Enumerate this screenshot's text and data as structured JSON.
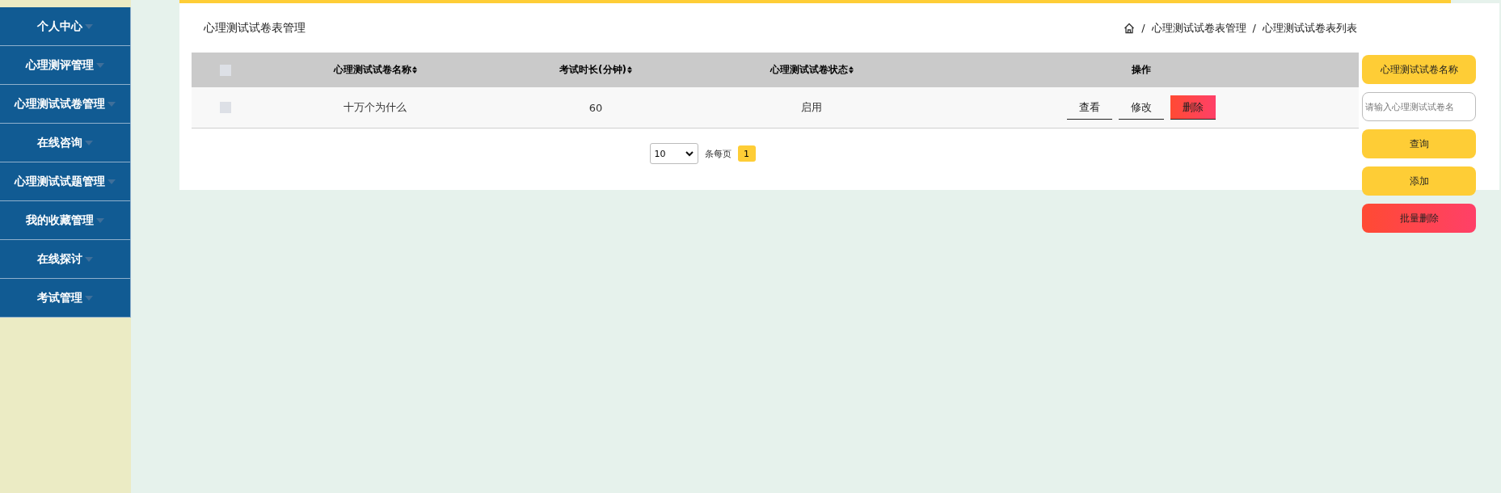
{
  "sidebar": {
    "items": [
      {
        "label": "个人中心",
        "expanded": false
      },
      {
        "label": "心理测评管理",
        "expanded": false
      },
      {
        "label": "心理测试试卷管理",
        "expanded": false
      },
      {
        "label": "在线咨询",
        "expanded": false
      },
      {
        "label": "心理测试试题管理",
        "expanded": false
      },
      {
        "label": "我的收藏管理",
        "expanded": false
      },
      {
        "label": "在线探讨",
        "expanded": false
      },
      {
        "label": "考试管理",
        "expanded": false
      }
    ]
  },
  "page_title": "心理测试试卷表管理",
  "breadcrumb": [
    {
      "separator": "/",
      "label": "心理测试试卷表管理"
    },
    {
      "separator": "/",
      "label": "心理测试试卷表列表"
    }
  ],
  "table": {
    "select_all_checked": false,
    "columns": [
      "心理测试试卷名称",
      "考试时长(分钟)",
      "心理测试试卷状态",
      "操作"
    ],
    "rows": [
      {
        "checked": false,
        "cells": [
          "十万个为什么",
          "60",
          "启用"
        ],
        "actions": [
          {
            "label": "查看",
            "kind": "plain"
          },
          {
            "label": "修改",
            "kind": "plain"
          },
          {
            "label": "删除",
            "kind": "danger"
          }
        ]
      }
    ]
  },
  "pagination": {
    "page_size": "10",
    "per_page_label": "条每页",
    "pages": [
      {
        "label": "1",
        "selected": true
      }
    ]
  },
  "search": {
    "label": "心理测试试卷名称",
    "placeholder": "请输入心理测试试卷名"
  },
  "buttons": [
    {
      "label": "查询",
      "kind": "primary"
    },
    {
      "label": "添加",
      "kind": "primary"
    },
    {
      "label": "批量删除",
      "kind": "danger"
    }
  ]
}
